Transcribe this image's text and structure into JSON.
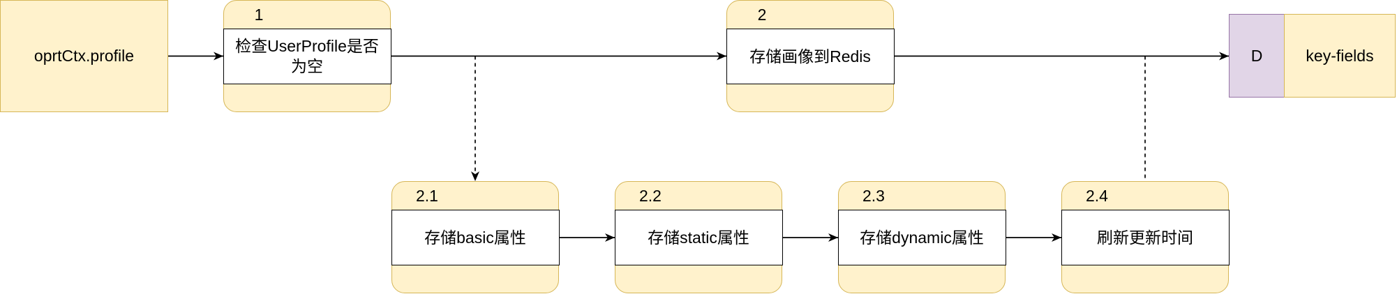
{
  "source": {
    "label": "oprtCtx.profile"
  },
  "processes": [
    {
      "id": "1",
      "label": "检查UserProfile是否为空"
    },
    {
      "id": "2",
      "label": "存储画像到Redis"
    }
  ],
  "subprocesses": [
    {
      "id": "2.1",
      "label": "存储basic属性"
    },
    {
      "id": "2.2",
      "label": "存储static属性"
    },
    {
      "id": "2.3",
      "label": "存储dynamic属性"
    },
    {
      "id": "2.4",
      "label": "刷新更新时间"
    }
  ],
  "datastore": {
    "id": "D",
    "label": "key-fields"
  },
  "colors": {
    "process_fill": "#fff2cc",
    "process_stroke": "#d6b656",
    "store_id_fill": "#e1d5e7",
    "store_id_stroke": "#9673a6",
    "line": "#000000"
  }
}
